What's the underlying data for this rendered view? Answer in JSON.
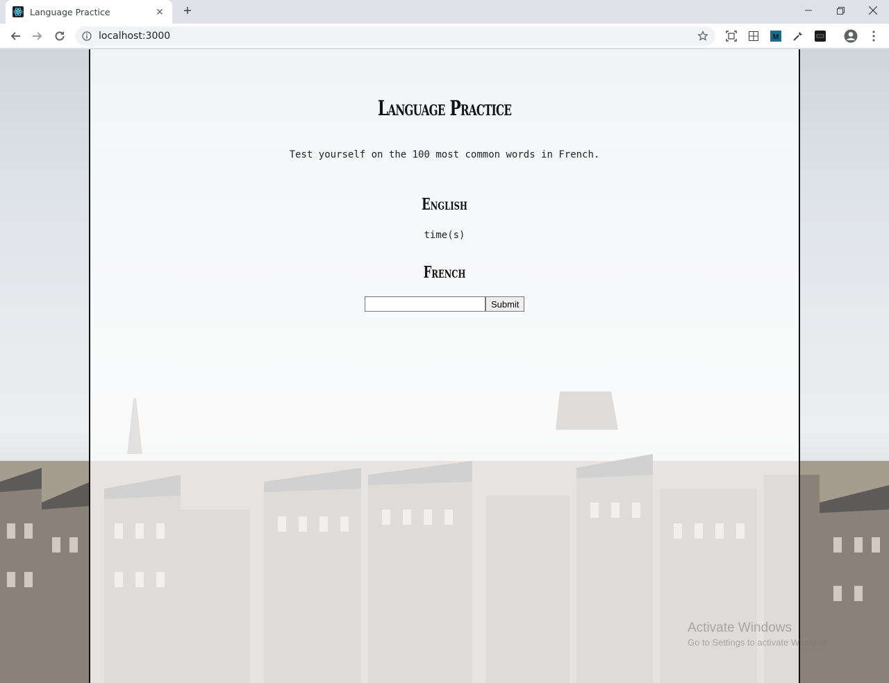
{
  "browser": {
    "tab_title": "Language Practice",
    "url": "localhost:3000",
    "icons": [
      "react-favicon",
      "close-icon",
      "plus-icon",
      "minimize-icon",
      "restore-icon",
      "window-close-icon",
      "back-arrow-icon",
      "forward-arrow-icon",
      "reload-icon",
      "info-icon",
      "star-icon",
      "screenshot-icon",
      "grid-icon",
      "extension-m-icon",
      "eyedropper-icon",
      "extension-dark-icon",
      "profile-icon",
      "kebab-menu-icon"
    ]
  },
  "page": {
    "title": "Language Practice",
    "subtitle": "Test yourself on the 100 most common words in French.",
    "english_heading": "English",
    "english_word": "time(s)",
    "french_heading": "French",
    "answer_value": "",
    "submit_label": "Submit"
  },
  "watermark": {
    "line1": "Activate Windows",
    "line2": "Go to Settings to activate Windows."
  },
  "colors": {
    "chrome_bg": "#dee1e6",
    "panel_border": "#111111"
  }
}
